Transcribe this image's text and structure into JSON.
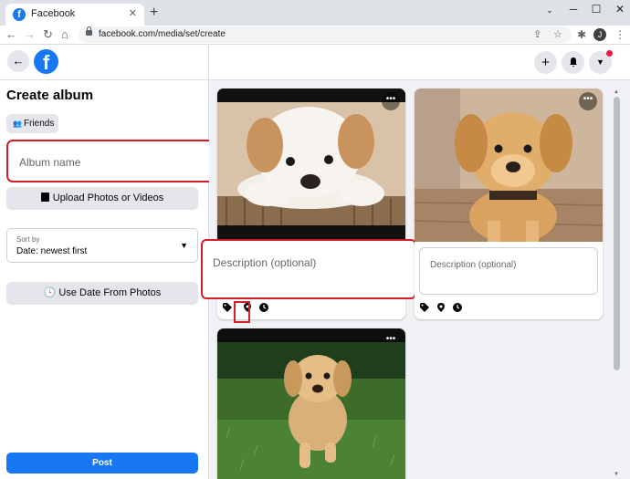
{
  "browser": {
    "tab_title": "Facebook",
    "tab_favicon": "f",
    "url": "facebook.com/media/set/create",
    "profile_initial": "J"
  },
  "left_panel": {
    "title": "Create album",
    "privacy_label": "Friends",
    "album_name_placeholder": "Album name",
    "upload_label": "Upload Photos or Videos",
    "sort_label": "Sort by",
    "sort_value": "Date: newest first",
    "date_button_label": "Use Date From Photos",
    "post_label": "Post"
  },
  "photos": [
    {
      "subject": "fluffy white and tan puppy lying down",
      "description_placeholder": "Description (optional)"
    },
    {
      "subject": "golden retriever puppy",
      "description_placeholder": "Description (optional)"
    },
    {
      "subject": "puppy running on grass"
    }
  ],
  "colors": {
    "facebook_blue": "#1877f2",
    "highlight_red": "#d21f26",
    "panel_bg": "#f0f2f5"
  },
  "icons": [
    "back-arrow-icon",
    "facebook-logo",
    "plus-icon",
    "bell-icon",
    "chevron-down-icon",
    "tag-icon",
    "location-pin-icon",
    "clock-icon",
    "more-icon"
  ]
}
